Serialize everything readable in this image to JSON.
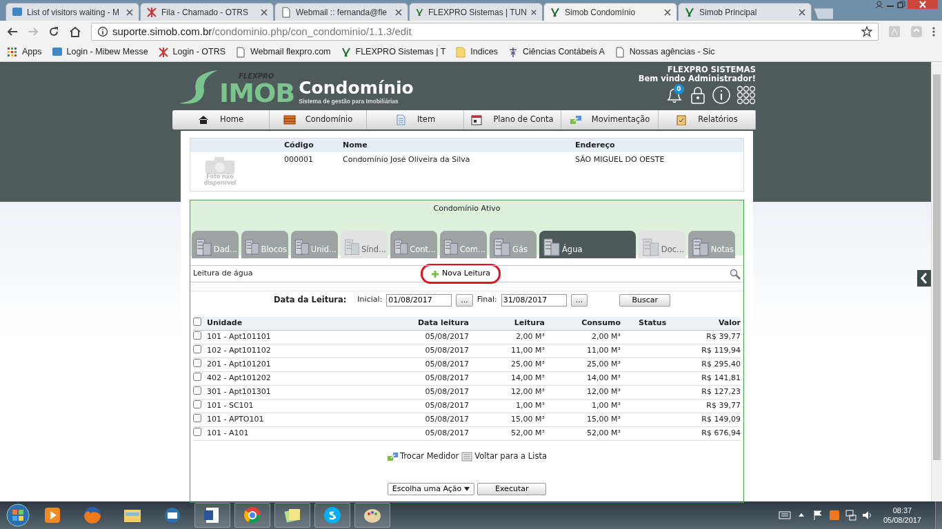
{
  "browser": {
    "tabs": [
      {
        "title": "List of visitors waiting - M",
        "selected": false
      },
      {
        "title": "Fila - Chamado - OTRS",
        "selected": false
      },
      {
        "title": "Webmail :: fernanda@fle",
        "selected": false
      },
      {
        "title": "FLEXPRO Sistemas | TUN",
        "selected": false
      },
      {
        "title": "Simob Condomínio",
        "selected": true
      },
      {
        "title": "Simob Principal",
        "selected": false
      }
    ],
    "url_host": "suporte.simob.com.br",
    "url_path": "/condominio.php/con_condominio/1.1.3/edit",
    "bookmarks": [
      "Apps",
      "Login - Mibew Messe",
      "Login - OTRS",
      "Webmail flexpro.com",
      "FLEXPRO Sistemas | T",
      "Indices",
      "Ciências Contábeis A",
      "Nossas agências - Sic"
    ]
  },
  "header": {
    "brand": "FLEXPRO",
    "logo": "IMOB",
    "product": "Condomínio",
    "tagline": "Sistema de gestão para Imobiliárias",
    "company": "FLEXPRO SISTEMAS",
    "welcome": "Bem vindo Administrador!",
    "notifications": "0"
  },
  "menu": [
    {
      "label": "Home"
    },
    {
      "label": "Condomínio"
    },
    {
      "label": "Item"
    },
    {
      "label": "Plano de Conta"
    },
    {
      "label": "Movimentação"
    },
    {
      "label": "Relatórios"
    }
  ],
  "condominio": {
    "columns": [
      "Código",
      "Nome",
      "Endereço"
    ],
    "photo_caption": "Foto não disponível",
    "codigo": "000001",
    "nome": "Condomínio José Oliveira da Silva",
    "endereco": "SÃO MIGUEL DO OESTE"
  },
  "panel": {
    "status": "Condomínio Ativo",
    "tabs": [
      {
        "label": "Dad...",
        "selected": false,
        "disabled": false
      },
      {
        "label": "Blocos",
        "selected": false,
        "disabled": false
      },
      {
        "label": "Unid...",
        "selected": false,
        "disabled": false
      },
      {
        "label": "Sínd...",
        "selected": false,
        "disabled": true
      },
      {
        "label": "Cont...",
        "selected": false,
        "disabled": false
      },
      {
        "label": "Com...",
        "selected": false,
        "disabled": false
      },
      {
        "label": "Gás",
        "selected": false,
        "disabled": false
      },
      {
        "label": "Água",
        "selected": true,
        "disabled": false
      },
      {
        "label": "Doc...",
        "selected": false,
        "disabled": true
      },
      {
        "label": "Notas",
        "selected": false,
        "disabled": false
      }
    ],
    "section_title": "Leitura de água",
    "new_button": {
      "label": "Nova Leitura",
      "highlighted": true
    },
    "filter": {
      "label": "Data da Leitura:",
      "start_label": "Inicial:",
      "start": "01/08/2017",
      "end_label": "Final:",
      "end": "31/08/2017",
      "picker": "...",
      "search": "Buscar"
    },
    "table": {
      "all_checked": false,
      "columns": [
        "Unidade",
        "Data leitura",
        "Leitura",
        "Consumo",
        "Status",
        "Valor"
      ],
      "rows": [
        {
          "checked": false,
          "unidade": "101 - Apt101101",
          "data": "05/08/2017",
          "leitura": "2,00 M³",
          "consumo": "2,00 M³",
          "valor": "R$ 39,77"
        },
        {
          "checked": false,
          "unidade": "102 - Apt101102",
          "data": "05/08/2017",
          "leitura": "11,00 M³",
          "consumo": "11,00 M³",
          "valor": "R$ 119,94"
        },
        {
          "checked": false,
          "unidade": "201 - Apt101201",
          "data": "05/08/2017",
          "leitura": "25,00 M³",
          "consumo": "25,00 M³",
          "valor": "R$ 295,40"
        },
        {
          "checked": false,
          "unidade": "402 - Apt101202",
          "data": "05/08/2017",
          "leitura": "14,00 M³",
          "consumo": "14,00 M³",
          "valor": "R$ 141,81"
        },
        {
          "checked": false,
          "unidade": "301 - Apt101301",
          "data": "05/08/2017",
          "leitura": "12,00 M³",
          "consumo": "12,00 M³",
          "valor": "R$ 127,23"
        },
        {
          "checked": false,
          "unidade": "101 - SC101",
          "data": "05/08/2017",
          "leitura": "1,00 M³",
          "consumo": "1,00 M³",
          "valor": "R$ 39,77"
        },
        {
          "checked": false,
          "unidade": "101 - APTO101",
          "data": "05/08/2017",
          "leitura": "15,00 M³",
          "consumo": "15,00 M³",
          "valor": "R$ 149,09"
        },
        {
          "checked": false,
          "unidade": "101 - A101",
          "data": "05/08/2017",
          "leitura": "52,00 M³",
          "consumo": "52,00 M³",
          "valor": "R$ 676,94"
        }
      ]
    },
    "links": [
      "Trocar Medidor",
      "Voltar para a Lista"
    ],
    "action": "Escolha uma Ação",
    "execute": "Executar"
  },
  "taskbar": {
    "time": "08:37",
    "date": "05/08/2017"
  }
}
